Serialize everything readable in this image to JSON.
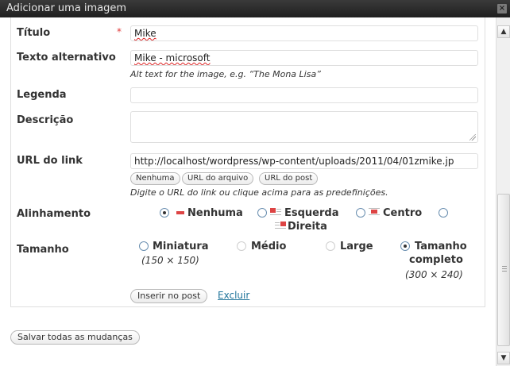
{
  "window": {
    "title": "Adicionar uma imagem",
    "close_glyph": "×"
  },
  "form": {
    "titulo": {
      "label": "Título",
      "required_mark": "*",
      "value": "Mike"
    },
    "alt": {
      "label": "Texto alternativo",
      "value": "Mike - microsoft",
      "help": "Alt text for the image, e.g. “The Mona Lisa”"
    },
    "legenda": {
      "label": "Legenda",
      "value": ""
    },
    "descricao": {
      "label": "Descrição",
      "value": ""
    },
    "url": {
      "label": "URL do link",
      "value": "http://localhost/wordpress/wp-content/uploads/2011/04/01zmike.jp",
      "buttons": [
        "Nenhuma",
        "URL do arquivo",
        "URL do post"
      ],
      "help": "Digite o URL do link ou clique acima para as predefinições."
    },
    "alinhamento": {
      "label": "Alinhamento",
      "options": [
        "Nenhuma",
        "Esquerda",
        "Centro",
        "Direita"
      ],
      "selected": "Nenhuma"
    },
    "tamanho": {
      "label": "Tamanho",
      "options": [
        {
          "label": "Miniatura",
          "note": "(150 × 150)"
        },
        {
          "label": "Médio",
          "note": ""
        },
        {
          "label": "Large",
          "note": ""
        },
        {
          "label": "Tamanho completo",
          "line1": "Tamanho",
          "line2": "completo",
          "note": "(300 × 240)"
        }
      ],
      "selected": "Tamanho completo"
    },
    "insert_button": "Inserir no post",
    "delete_link": "Excluir"
  },
  "footer": {
    "save_all_button": "Salvar todas as mudanças"
  },
  "colors": {
    "titlebar": "#2b2b2b",
    "link": "#21759b",
    "required": "#e03b3b"
  },
  "icons": {
    "close": "close-icon",
    "scroll_up": "scroll-up-icon",
    "scroll_down": "scroll-down-icon"
  }
}
